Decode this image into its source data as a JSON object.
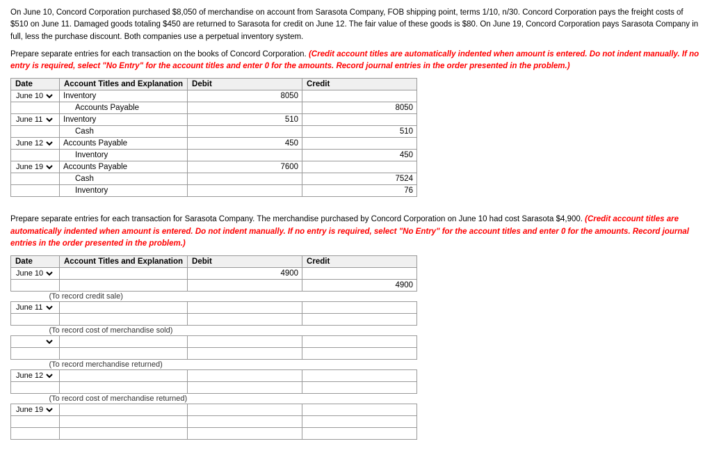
{
  "intro": {
    "text": "On June 10, Concord Corporation purchased $8,050 of merchandise on account from Sarasota Company, FOB shipping point, terms 1/10, n/30. Concord Corporation pays the freight costs of $510 on June 11. Damaged goods totaling $450 are returned to Sarasota for credit on June 12. The fair value of these goods is $80. On June 19, Concord Corporation pays Sarasota Company in full, less the purchase discount. Both companies use a perpetual inventory system."
  },
  "instruction1": {
    "static": "Prepare separate entries for each transaction on the books of Concord Corporation.",
    "bold_italic": "(Credit account titles are automatically indented when amount is entered. Do not indent manually. If no entry is required, select \"No Entry\" for the account titles and enter 0 for the amounts. Record journal entries in the order presented in the problem.)"
  },
  "instruction2": {
    "static": "Prepare separate entries for each transaction for Sarasota Company. The merchandise purchased by Concord Corporation on June 10 had cost Sarasota $4,900.",
    "bold_italic": "(Credit account titles are automatically indented when amount is entered. Do not indent manually. If no entry is required, select \"No Entry\" for the account titles and enter 0 for the amounts. Record journal entries in the order presented in the problem.)"
  },
  "table1": {
    "headers": [
      "Date",
      "Account Titles and Explanation",
      "Debit",
      "Credit"
    ],
    "rows": [
      {
        "date": "June 10",
        "account": "Inventory",
        "debit": "8050",
        "credit": "",
        "indent": false
      },
      {
        "date": "",
        "account": "Accounts Payable",
        "debit": "",
        "credit": "8050",
        "indent": true
      },
      {
        "date": "June 11",
        "account": "Inventory",
        "debit": "510",
        "credit": "",
        "indent": false
      },
      {
        "date": "",
        "account": "Cash",
        "debit": "",
        "credit": "510",
        "indent": true
      },
      {
        "date": "June 12",
        "account": "Accounts Payable",
        "debit": "450",
        "credit": "",
        "indent": false
      },
      {
        "date": "",
        "account": "Inventory",
        "debit": "",
        "credit": "450",
        "indent": true
      },
      {
        "date": "June 19",
        "account": "Accounts Payable",
        "debit": "7600",
        "credit": "",
        "indent": false
      },
      {
        "date": "",
        "account": "Cash",
        "debit": "",
        "credit": "7524",
        "indent": true
      },
      {
        "date": "",
        "account": "Inventory",
        "debit": "",
        "credit": "76",
        "indent": true
      }
    ]
  },
  "table2": {
    "headers": [
      "Date",
      "Account Titles and Explanation",
      "Debit",
      "Credit"
    ],
    "sections": [
      {
        "date": "June 10",
        "rows": [
          {
            "account": "",
            "debit": "4900",
            "credit": "",
            "indent": false
          },
          {
            "account": "",
            "debit": "",
            "credit": "4900",
            "indent": false
          }
        ],
        "note": "(To record credit sale)"
      },
      {
        "date": "June 11",
        "rows": [
          {
            "account": "",
            "debit": "",
            "credit": "",
            "indent": false
          },
          {
            "account": "",
            "debit": "",
            "credit": "",
            "indent": false
          }
        ],
        "note": "(To record cost of merchandise sold)"
      },
      {
        "date": "",
        "rows": [
          {
            "account": "",
            "debit": "",
            "credit": "",
            "indent": false
          },
          {
            "account": "",
            "debit": "",
            "credit": "",
            "indent": false
          }
        ],
        "note": "(To record merchandise returned)"
      },
      {
        "date": "June 12",
        "rows": [
          {
            "account": "",
            "debit": "",
            "credit": "",
            "indent": false
          },
          {
            "account": "",
            "debit": "",
            "credit": "",
            "indent": false
          }
        ],
        "note": "(To record cost of merchandise returned)"
      },
      {
        "date": "June 19",
        "rows": [
          {
            "account": "",
            "debit": "",
            "credit": "",
            "indent": false
          },
          {
            "account": "",
            "debit": "",
            "credit": "",
            "indent": false
          },
          {
            "account": "",
            "debit": "",
            "credit": "",
            "indent": false
          }
        ],
        "note": ""
      }
    ]
  },
  "labels": {
    "date": "Date",
    "account": "Account Titles and Explanation",
    "debit": "Debit",
    "credit": "Credit"
  }
}
